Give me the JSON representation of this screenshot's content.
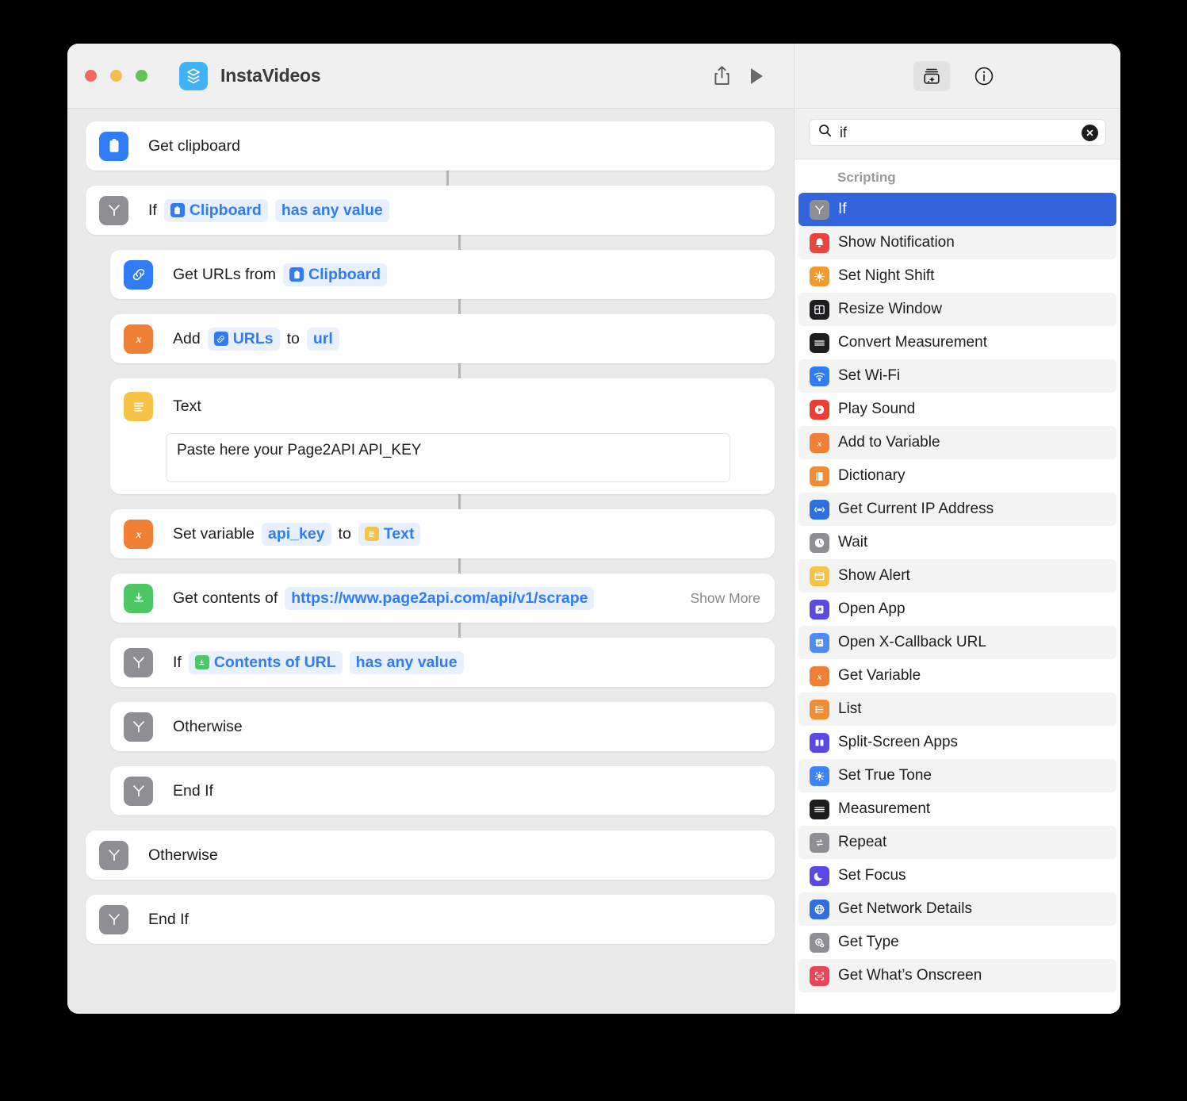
{
  "window": {
    "app_icon": "layers-stack-icon",
    "title": "InstaVideos",
    "traffic_lights": [
      "close-red",
      "minimize-yellow",
      "zoom-green"
    ],
    "toolbar": {
      "share_label": "Share",
      "share_icon": "share-up-arrow-icon",
      "run_label": "Run",
      "run_icon": "play-triangle-icon"
    }
  },
  "workflow": {
    "steps": [
      {
        "name": "get-clipboard",
        "indent": 0,
        "icon": "clipboard-icon",
        "icon_color": "#2f7cf6",
        "label": "Get clipboard",
        "parts": []
      },
      {
        "name": "if-clipboard",
        "indent": 0,
        "icon": "branch-icon",
        "icon_color": "#8e8e93",
        "label": "If",
        "parts": [
          {
            "kind": "token",
            "text": "Clipboard",
            "mini_icon": "clipboard-icon",
            "mini_color": "#2f7cf6"
          },
          {
            "kind": "token",
            "text": "has any value",
            "mini_icon": null,
            "mini_color": null
          }
        ]
      },
      {
        "name": "get-urls-from-clipboard",
        "indent": 1,
        "icon": "link-icon",
        "icon_color": "#2f7cf6",
        "label": "Get URLs from",
        "parts": [
          {
            "kind": "token",
            "text": "Clipboard",
            "mini_icon": "clipboard-icon",
            "mini_color": "#2f7cf6"
          }
        ]
      },
      {
        "name": "add-urls-to-url",
        "indent": 1,
        "icon": "variable-x-icon",
        "icon_color": "#ef8035",
        "label": "Add",
        "parts": [
          {
            "kind": "token",
            "text": "URLs",
            "mini_icon": "link-icon",
            "mini_color": "#2f7cf6"
          },
          {
            "kind": "word",
            "text": "to"
          },
          {
            "kind": "token",
            "text": "url",
            "mini_icon": null,
            "mini_color": null
          }
        ]
      },
      {
        "name": "text-action",
        "indent": 1,
        "icon": "text-lines-icon",
        "icon_color": "#f6c344",
        "label": "Text",
        "parts": [],
        "textfield_value": "Paste here your Page2API API_KEY"
      },
      {
        "name": "set-variable-api-key",
        "indent": 1,
        "icon": "variable-x-icon",
        "icon_color": "#ef8035",
        "label": "Set variable",
        "parts": [
          {
            "kind": "token",
            "text": "api_key",
            "mini_icon": null,
            "mini_color": null
          },
          {
            "kind": "word",
            "text": "to"
          },
          {
            "kind": "token",
            "text": "Text",
            "mini_icon": "text-lines-icon",
            "mini_color": "#f6c344"
          }
        ]
      },
      {
        "name": "get-contents-of-url",
        "indent": 1,
        "icon": "download-box-icon",
        "icon_color": "#4cc764",
        "label": "Get contents of",
        "parts": [
          {
            "kind": "token",
            "text": "https://www.page2api.com/api/v1/scrape",
            "mini_icon": null,
            "mini_color": null
          }
        ],
        "show_more_label": "Show More"
      },
      {
        "name": "if-contents-of-url",
        "indent": 1,
        "icon": "branch-icon",
        "icon_color": "#8e8e93",
        "label": "If",
        "parts": [
          {
            "kind": "token",
            "text": "Contents of URL",
            "mini_icon": "download-box-icon",
            "mini_color": "#4cc764"
          },
          {
            "kind": "token",
            "text": "has any value",
            "mini_icon": null,
            "mini_color": null
          }
        ]
      },
      {
        "name": "otherwise-inner",
        "indent": 1,
        "icon": "branch-icon",
        "icon_color": "#8e8e93",
        "label": "Otherwise",
        "parts": []
      },
      {
        "name": "end-if-inner",
        "indent": 1,
        "icon": "branch-icon",
        "icon_color": "#8e8e93",
        "label": "End If",
        "parts": []
      },
      {
        "name": "otherwise-outer",
        "indent": 0,
        "icon": "branch-icon",
        "icon_color": "#8e8e93",
        "label": "Otherwise",
        "parts": []
      },
      {
        "name": "end-if-outer",
        "indent": 0,
        "icon": "branch-icon",
        "icon_color": "#8e8e93",
        "label": "End If",
        "parts": []
      }
    ]
  },
  "library": {
    "toolbar": {
      "actions_button": "action-library-icon",
      "info_button": "info-circle-icon"
    },
    "search": {
      "icon": "search-magnifier-icon",
      "value": "if",
      "placeholder": "Search",
      "clear_icon": "clear-circle-x-icon"
    },
    "group_title": "Scripting",
    "items": [
      {
        "label": "If",
        "icon": "branch-icon",
        "color": "#8e8e93",
        "selected": true
      },
      {
        "label": "Show Notification",
        "icon": "bell-icon",
        "color": "#e8453c",
        "selected": false
      },
      {
        "label": "Set Night Shift",
        "icon": "sun-icon",
        "color": "#f29a2e",
        "selected": false
      },
      {
        "label": "Resize Window",
        "icon": "window-grid-icon",
        "color": "#1d1d1f",
        "selected": false
      },
      {
        "label": "Convert Measurement",
        "icon": "ruler-icon",
        "color": "#1d1d1f",
        "selected": false
      },
      {
        "label": "Set Wi-Fi",
        "icon": "wifi-icon",
        "color": "#2f7cf6",
        "selected": false
      },
      {
        "label": "Play Sound",
        "icon": "play-circle-icon",
        "color": "#ee3e33",
        "selected": false
      },
      {
        "label": "Add to Variable",
        "icon": "variable-x-icon",
        "color": "#ef8035",
        "selected": false
      },
      {
        "label": "Dictionary",
        "icon": "book-icon",
        "color": "#ef8e35",
        "selected": false
      },
      {
        "label": "Get Current IP Address",
        "icon": "ellipsis-arrows-icon",
        "color": "#2f6fe0",
        "selected": false
      },
      {
        "label": "Wait",
        "icon": "clock-icon",
        "color": "#8e8e93",
        "selected": false
      },
      {
        "label": "Show Alert",
        "icon": "alert-window-icon",
        "color": "#f6c344",
        "selected": false
      },
      {
        "label": "Open App",
        "icon": "arrow-out-icon",
        "color": "#5b4ae0",
        "selected": false
      },
      {
        "label": "Open X-Callback URL",
        "icon": "callback-icon",
        "color": "#4f8df5",
        "selected": false
      },
      {
        "label": "Get Variable",
        "icon": "variable-x-icon",
        "color": "#ef8035",
        "selected": false
      },
      {
        "label": "List",
        "icon": "list-lines-icon",
        "color": "#ef8e35",
        "selected": false
      },
      {
        "label": "Split-Screen Apps",
        "icon": "split-columns-icon",
        "color": "#5b4ae0",
        "selected": false
      },
      {
        "label": "Set True Tone",
        "icon": "brightness-icon",
        "color": "#3e82f7",
        "selected": false
      },
      {
        "label": "Measurement",
        "icon": "ruler-icon",
        "color": "#1d1d1f",
        "selected": false
      },
      {
        "label": "Repeat",
        "icon": "repeat-arrows-icon",
        "color": "#8e8e93",
        "selected": false
      },
      {
        "label": "Set Focus",
        "icon": "moon-icon",
        "color": "#5b4ae0",
        "selected": false
      },
      {
        "label": "Get Network Details",
        "icon": "globe-icon",
        "color": "#2f6fe0",
        "selected": false
      },
      {
        "label": "Get Type",
        "icon": "gear-cursor-icon",
        "color": "#8e8e93",
        "selected": false
      },
      {
        "label": "Get What’s Onscreen",
        "icon": "scan-frame-icon",
        "color": "#e8445a",
        "selected": false
      }
    ]
  }
}
